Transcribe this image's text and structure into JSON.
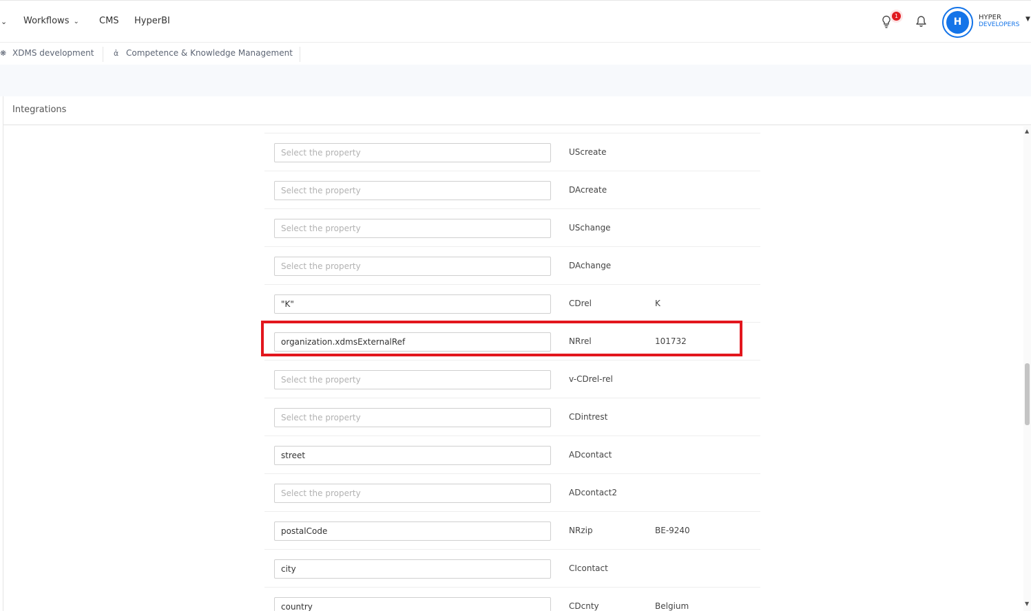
{
  "nav": {
    "workflows_label": "Workflows",
    "cms_label": "CMS",
    "hyperbi_label": "HyperBI",
    "notification_count": "1",
    "avatar_initial": "H",
    "brand_line1": "HYPER",
    "brand_line2": "DEVELOPERS"
  },
  "subnav": {
    "items": [
      {
        "label": "XDMS development",
        "icon": "bug-icon"
      },
      {
        "label": "Competence & Knowledge Management",
        "icon": "fork-icon"
      }
    ]
  },
  "panel": {
    "title": "Integrations"
  },
  "mappings": [
    {
      "input_value": "",
      "placeholder": "Select the property",
      "field": "UScreate",
      "value": ""
    },
    {
      "input_value": "",
      "placeholder": "Select the property",
      "field": "DAcreate",
      "value": ""
    },
    {
      "input_value": "",
      "placeholder": "Select the property",
      "field": "USchange",
      "value": ""
    },
    {
      "input_value": "",
      "placeholder": "Select the property",
      "field": "DAchange",
      "value": ""
    },
    {
      "input_value": "\"K\"",
      "placeholder": "Select the property",
      "field": "CDrel",
      "value": "K"
    },
    {
      "input_value": "organization.xdmsExternalRef",
      "placeholder": "Select the property",
      "field": "NRrel",
      "value": "101732"
    },
    {
      "input_value": "",
      "placeholder": "Select the property",
      "field": "v-CDrel-rel",
      "value": ""
    },
    {
      "input_value": "",
      "placeholder": "Select the property",
      "field": "CDintrest",
      "value": ""
    },
    {
      "input_value": "street",
      "placeholder": "Select the property",
      "field": "ADcontact",
      "value": ""
    },
    {
      "input_value": "",
      "placeholder": "Select the property",
      "field": "ADcontact2",
      "value": ""
    },
    {
      "input_value": "postalCode",
      "placeholder": "Select the property",
      "field": "NRzip",
      "value": "BE-9240"
    },
    {
      "input_value": "city",
      "placeholder": "Select the property",
      "field": "CIcontact",
      "value": ""
    },
    {
      "input_value": "country",
      "placeholder": "Select the property",
      "field": "CDcnty",
      "value": "Belgium"
    }
  ],
  "colors": {
    "accent": "#1474e8",
    "highlight": "#e2161d",
    "badge": "#e0191e"
  }
}
